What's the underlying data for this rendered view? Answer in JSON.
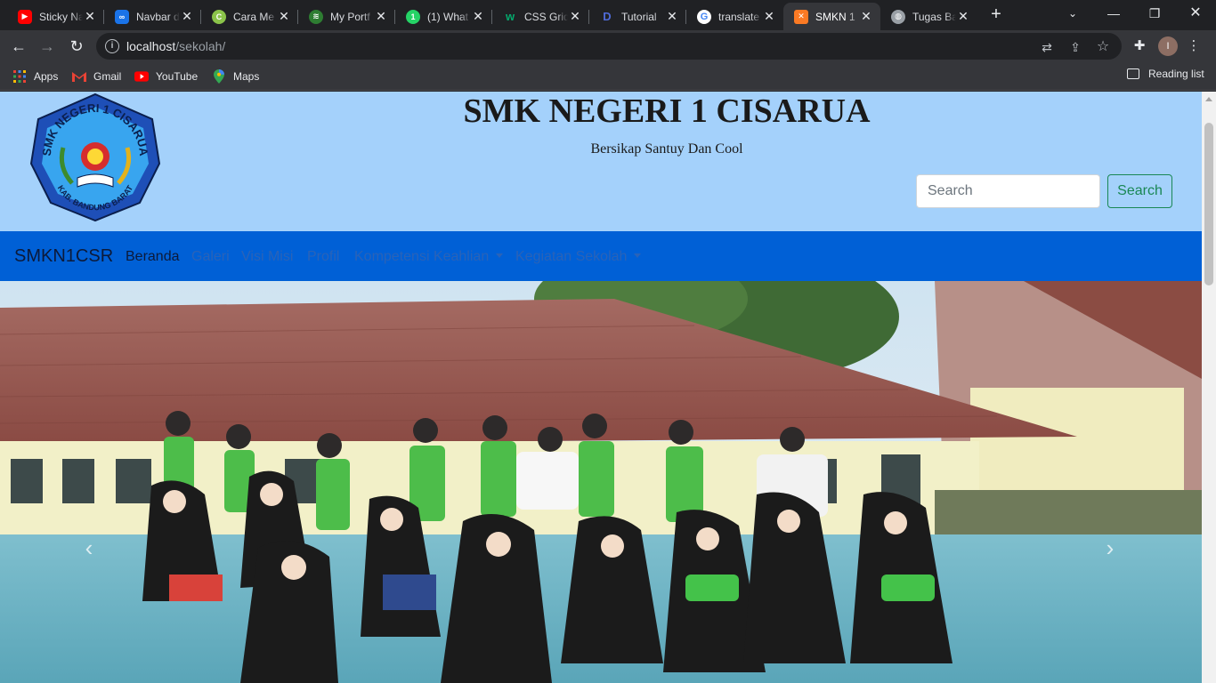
{
  "browser": {
    "tabs": [
      {
        "title": "Sticky Na",
        "icon": "youtube-icon",
        "color": "#ff0000"
      },
      {
        "title": "Navbar d",
        "icon": "link-icon",
        "color": "#1a73e8"
      },
      {
        "title": "Cara Me",
        "icon": "site-icon",
        "color": "#8bc34a"
      },
      {
        "title": "My Portf",
        "icon": "grid-icon",
        "color": "#2e7d32"
      },
      {
        "title": "(1) What",
        "icon": "whatsapp-icon",
        "color": "#25d366"
      },
      {
        "title": "CSS Grid",
        "icon": "w3schools-icon",
        "color": "#04aa6d"
      },
      {
        "title": "Tutorial",
        "icon": "dev-icon",
        "color": "#1e3a8a"
      },
      {
        "title": "translate",
        "icon": "google-icon",
        "color": "#4285f4"
      },
      {
        "title": "SMKN 1",
        "icon": "xampp-icon",
        "color": "#fb7a24"
      },
      {
        "title": "Tugas Ba",
        "icon": "globe-icon",
        "color": "#9aa0a6"
      }
    ],
    "url": {
      "host": "localhost",
      "path": "/sekolah/"
    },
    "bookmarks": [
      {
        "label": "Apps",
        "icon": "apps-grid-icon"
      },
      {
        "label": "Gmail",
        "icon": "gmail-icon"
      },
      {
        "label": "YouTube",
        "icon": "youtube-icon"
      },
      {
        "label": "Maps",
        "icon": "maps-pin-icon"
      }
    ],
    "reading_list": "Reading list",
    "profile_initial": "I"
  },
  "header": {
    "title": "SMK NEGERI 1 CISARUA",
    "tagline": "Bersikap Santuy Dan Cool",
    "search_placeholder": "Search",
    "search_button": "Search",
    "logo_text": "SMK NEGERI 1 CISARUA",
    "logo_subtext": "KAB. BANDUNG BARAT",
    "background": "#a4d1fb"
  },
  "navbar": {
    "brand": "SMKN1CSR",
    "links": [
      {
        "label": "Beranda",
        "active": true
      },
      {
        "label": "Galeri"
      },
      {
        "label": "Visi Misi"
      },
      {
        "label": "Profil"
      },
      {
        "label": "Kompetensi Keahlian",
        "dropdown": true
      },
      {
        "label": "Kegiatan Sekolah",
        "dropdown": true
      }
    ],
    "background": "#0060d6"
  },
  "carousel": {
    "prev_icon": "chevron-left-icon",
    "next_icon": "chevron-right-icon"
  }
}
